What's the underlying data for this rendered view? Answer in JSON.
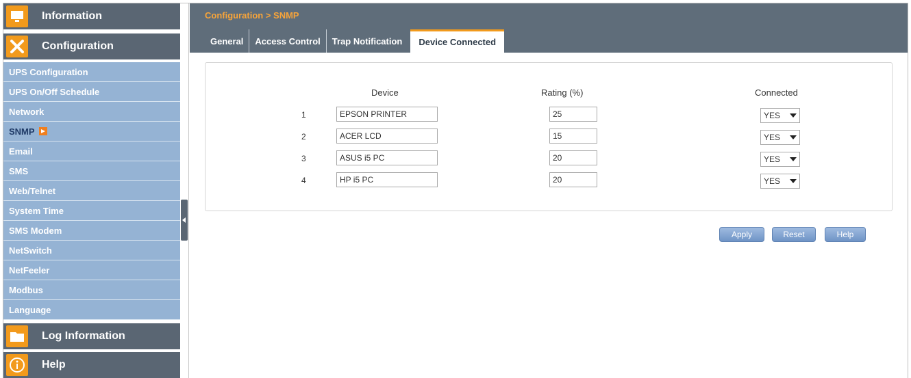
{
  "sidebar": {
    "sections": {
      "information": "Information",
      "configuration": "Configuration",
      "log_information": "Log Information",
      "help": "Help"
    },
    "items": [
      {
        "label": "UPS Configuration"
      },
      {
        "label": "UPS On/Off Schedule"
      },
      {
        "label": "Network"
      },
      {
        "label": "SNMP",
        "active": true
      },
      {
        "label": "Email"
      },
      {
        "label": "SMS"
      },
      {
        "label": "Web/Telnet"
      },
      {
        "label": "System Time"
      },
      {
        "label": "SMS Modem"
      },
      {
        "label": "NetSwitch"
      },
      {
        "label": "NetFeeler"
      },
      {
        "label": "Modbus"
      },
      {
        "label": "Language"
      }
    ]
  },
  "header": {
    "breadcrumb": "Configuration > SNMP",
    "tabs": [
      {
        "label": "General"
      },
      {
        "label": "Access Control"
      },
      {
        "label": "Trap Notification"
      },
      {
        "label": "Device Connected",
        "active": true
      }
    ]
  },
  "table": {
    "headers": {
      "device": "Device",
      "rating": "Rating (%)",
      "connected": "Connected"
    },
    "rows": [
      {
        "num": "1",
        "device": "EPSON PRINTER",
        "rating": "25",
        "connected": "YES"
      },
      {
        "num": "2",
        "device": "ACER LCD",
        "rating": "15",
        "connected": "YES"
      },
      {
        "num": "3",
        "device": "ASUS i5 PC",
        "rating": "20",
        "connected": "YES"
      },
      {
        "num": "4",
        "device": "HP i5 PC",
        "rating": "20",
        "connected": "YES"
      }
    ]
  },
  "buttons": {
    "apply": "Apply",
    "reset": "Reset",
    "help": "Help"
  },
  "colors": {
    "accent": "#f29a1c",
    "header_bg": "#5f6d7a",
    "sidebar_sub": "#95b3d4",
    "button": "#7fa1cf"
  }
}
